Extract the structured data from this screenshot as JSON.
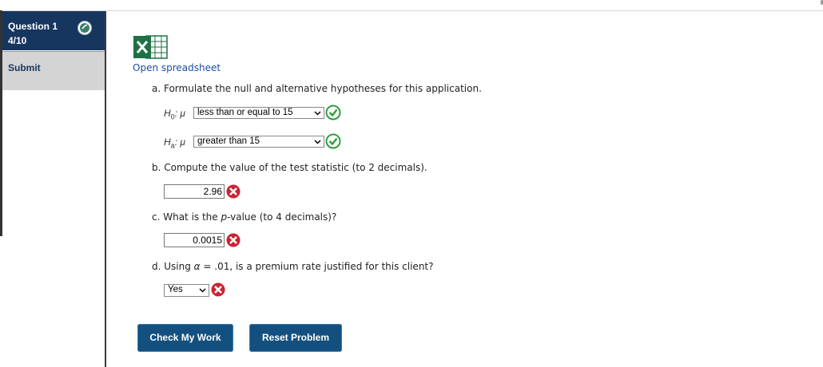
{
  "sidebar": {
    "question_title": "Question 1",
    "question_score": "4/10",
    "submit_label": "Submit"
  },
  "content": {
    "open_spreadsheet": "Open spreadsheet",
    "part_a": "a. Formulate the null and alternative hypotheses for this application.",
    "h0_label": "H",
    "h0_sub": "0",
    "ha_label": "H",
    "ha_sub": "a",
    "mu": ": μ",
    "h0_selected": "less than or equal to 15",
    "ha_selected": "greater than 15",
    "part_b": "b. Compute the value of the test statistic (to 2 decimals).",
    "test_stat_value": "2.96",
    "part_c_prefix": "c. What is the ",
    "part_c_italic": "p",
    "part_c_suffix": "-value (to 4 decimals)?",
    "p_value": "0.0015",
    "part_d_prefix": "d. Using ",
    "part_d_alpha": "α",
    "part_d_suffix": " = .01, is a premium rate justified for this client?",
    "d_selected": "Yes"
  },
  "buttons": {
    "check": "Check My Work",
    "reset": "Reset Problem"
  },
  "colors": {
    "header_bg": "#16355f",
    "button_bg": "#13507f",
    "correct": "#2e9e3e",
    "incorrect": "#cc2233",
    "link": "#1a4fa0"
  }
}
